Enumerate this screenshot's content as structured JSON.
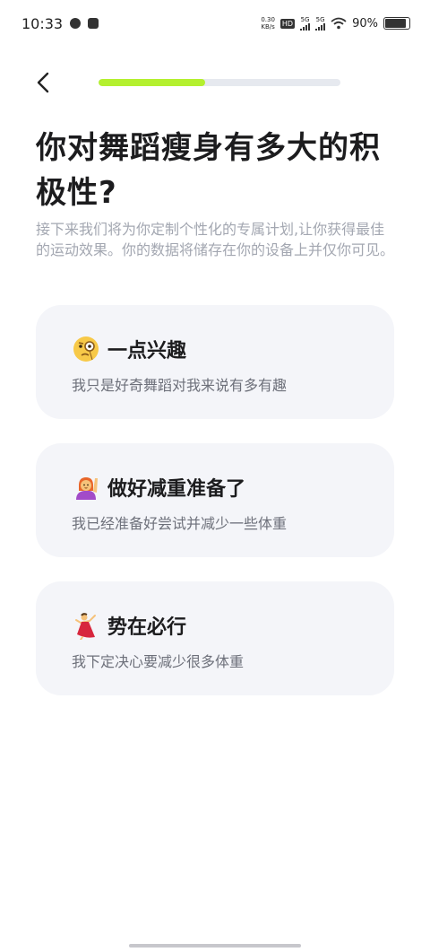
{
  "status_bar": {
    "time": "10:33",
    "net_speed_value": "0.30",
    "net_speed_unit": "KB/s",
    "hd_label": "HD",
    "sim1_label": "5G",
    "sim2_label": "5G",
    "battery_percent": "90%",
    "battery_level": 0.9
  },
  "progress": {
    "fraction": 0.44,
    "color": "#b4f02f",
    "track_color": "#e6e9ef"
  },
  "question": {
    "title": "你对舞蹈瘦身有多大的积极性?",
    "subtitle": "接下来我们将为你定制个性化的专属计划,让你获得最佳的运动效果。你的数据将储存在你的设备上并仅你可见。"
  },
  "options": [
    {
      "icon": "monocle-face-icon",
      "title": "一点兴趣",
      "desc": "我只是好奇舞蹈对我来说有多有趣"
    },
    {
      "icon": "person-raising-hand-icon",
      "title": "做好减重准备了",
      "desc": "我已经准备好尝试并减少一些体重"
    },
    {
      "icon": "dancer-icon",
      "title": "势在必行",
      "desc": "我下定决心要减少很多体重"
    }
  ]
}
